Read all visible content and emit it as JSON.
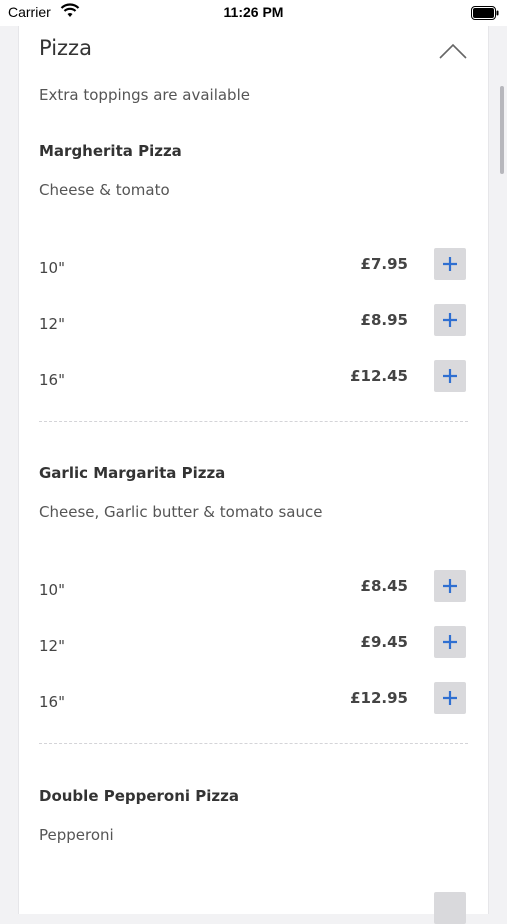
{
  "status_bar": {
    "carrier": "Carrier",
    "time": "11:26 PM"
  },
  "section": {
    "title": "Pizza",
    "subtitle": "Extra toppings are available",
    "collapse_icon": "chevron-up-icon"
  },
  "products": [
    {
      "name": "Margherita Pizza",
      "description": "Cheese & tomato",
      "sizes": [
        {
          "label": "10\"",
          "price": "£7.95"
        },
        {
          "label": "12\"",
          "price": "£8.95"
        },
        {
          "label": "16\"",
          "price": "£12.45"
        }
      ]
    },
    {
      "name": "Garlic Margarita Pizza",
      "description": "Cheese, Garlic butter & tomato sauce",
      "sizes": [
        {
          "label": "10\"",
          "price": "£8.45"
        },
        {
          "label": "12\"",
          "price": "£9.45"
        },
        {
          "label": "16\"",
          "price": "£12.95"
        }
      ]
    },
    {
      "name": "Double Pepperoni Pizza",
      "description": "Pepperoni",
      "sizes": []
    }
  ],
  "colors": {
    "accent": "#2f6fd1",
    "add_button_bg": "#d9d9dc"
  }
}
